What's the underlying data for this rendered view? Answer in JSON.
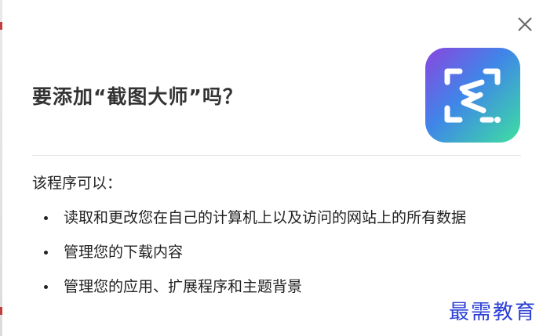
{
  "dialog": {
    "title": "要添加“截图大师”吗？",
    "close_icon": "close-icon",
    "app_icon": "screenshot-master-app-icon",
    "permissions_heading": "该程序可以：",
    "permissions": [
      "读取和更改您在自己的计算机上以及访问的网站上的所有数据",
      "管理您的下载内容",
      "管理您的应用、扩展程序和主题背景"
    ]
  },
  "watermark": {
    "text": "最需教育"
  },
  "colors": {
    "watermark": "#2b3fd6",
    "icon_gradient_start": "#7b4de0",
    "icon_gradient_mid": "#3d8be6",
    "icon_gradient_end": "#37d9a4"
  }
}
